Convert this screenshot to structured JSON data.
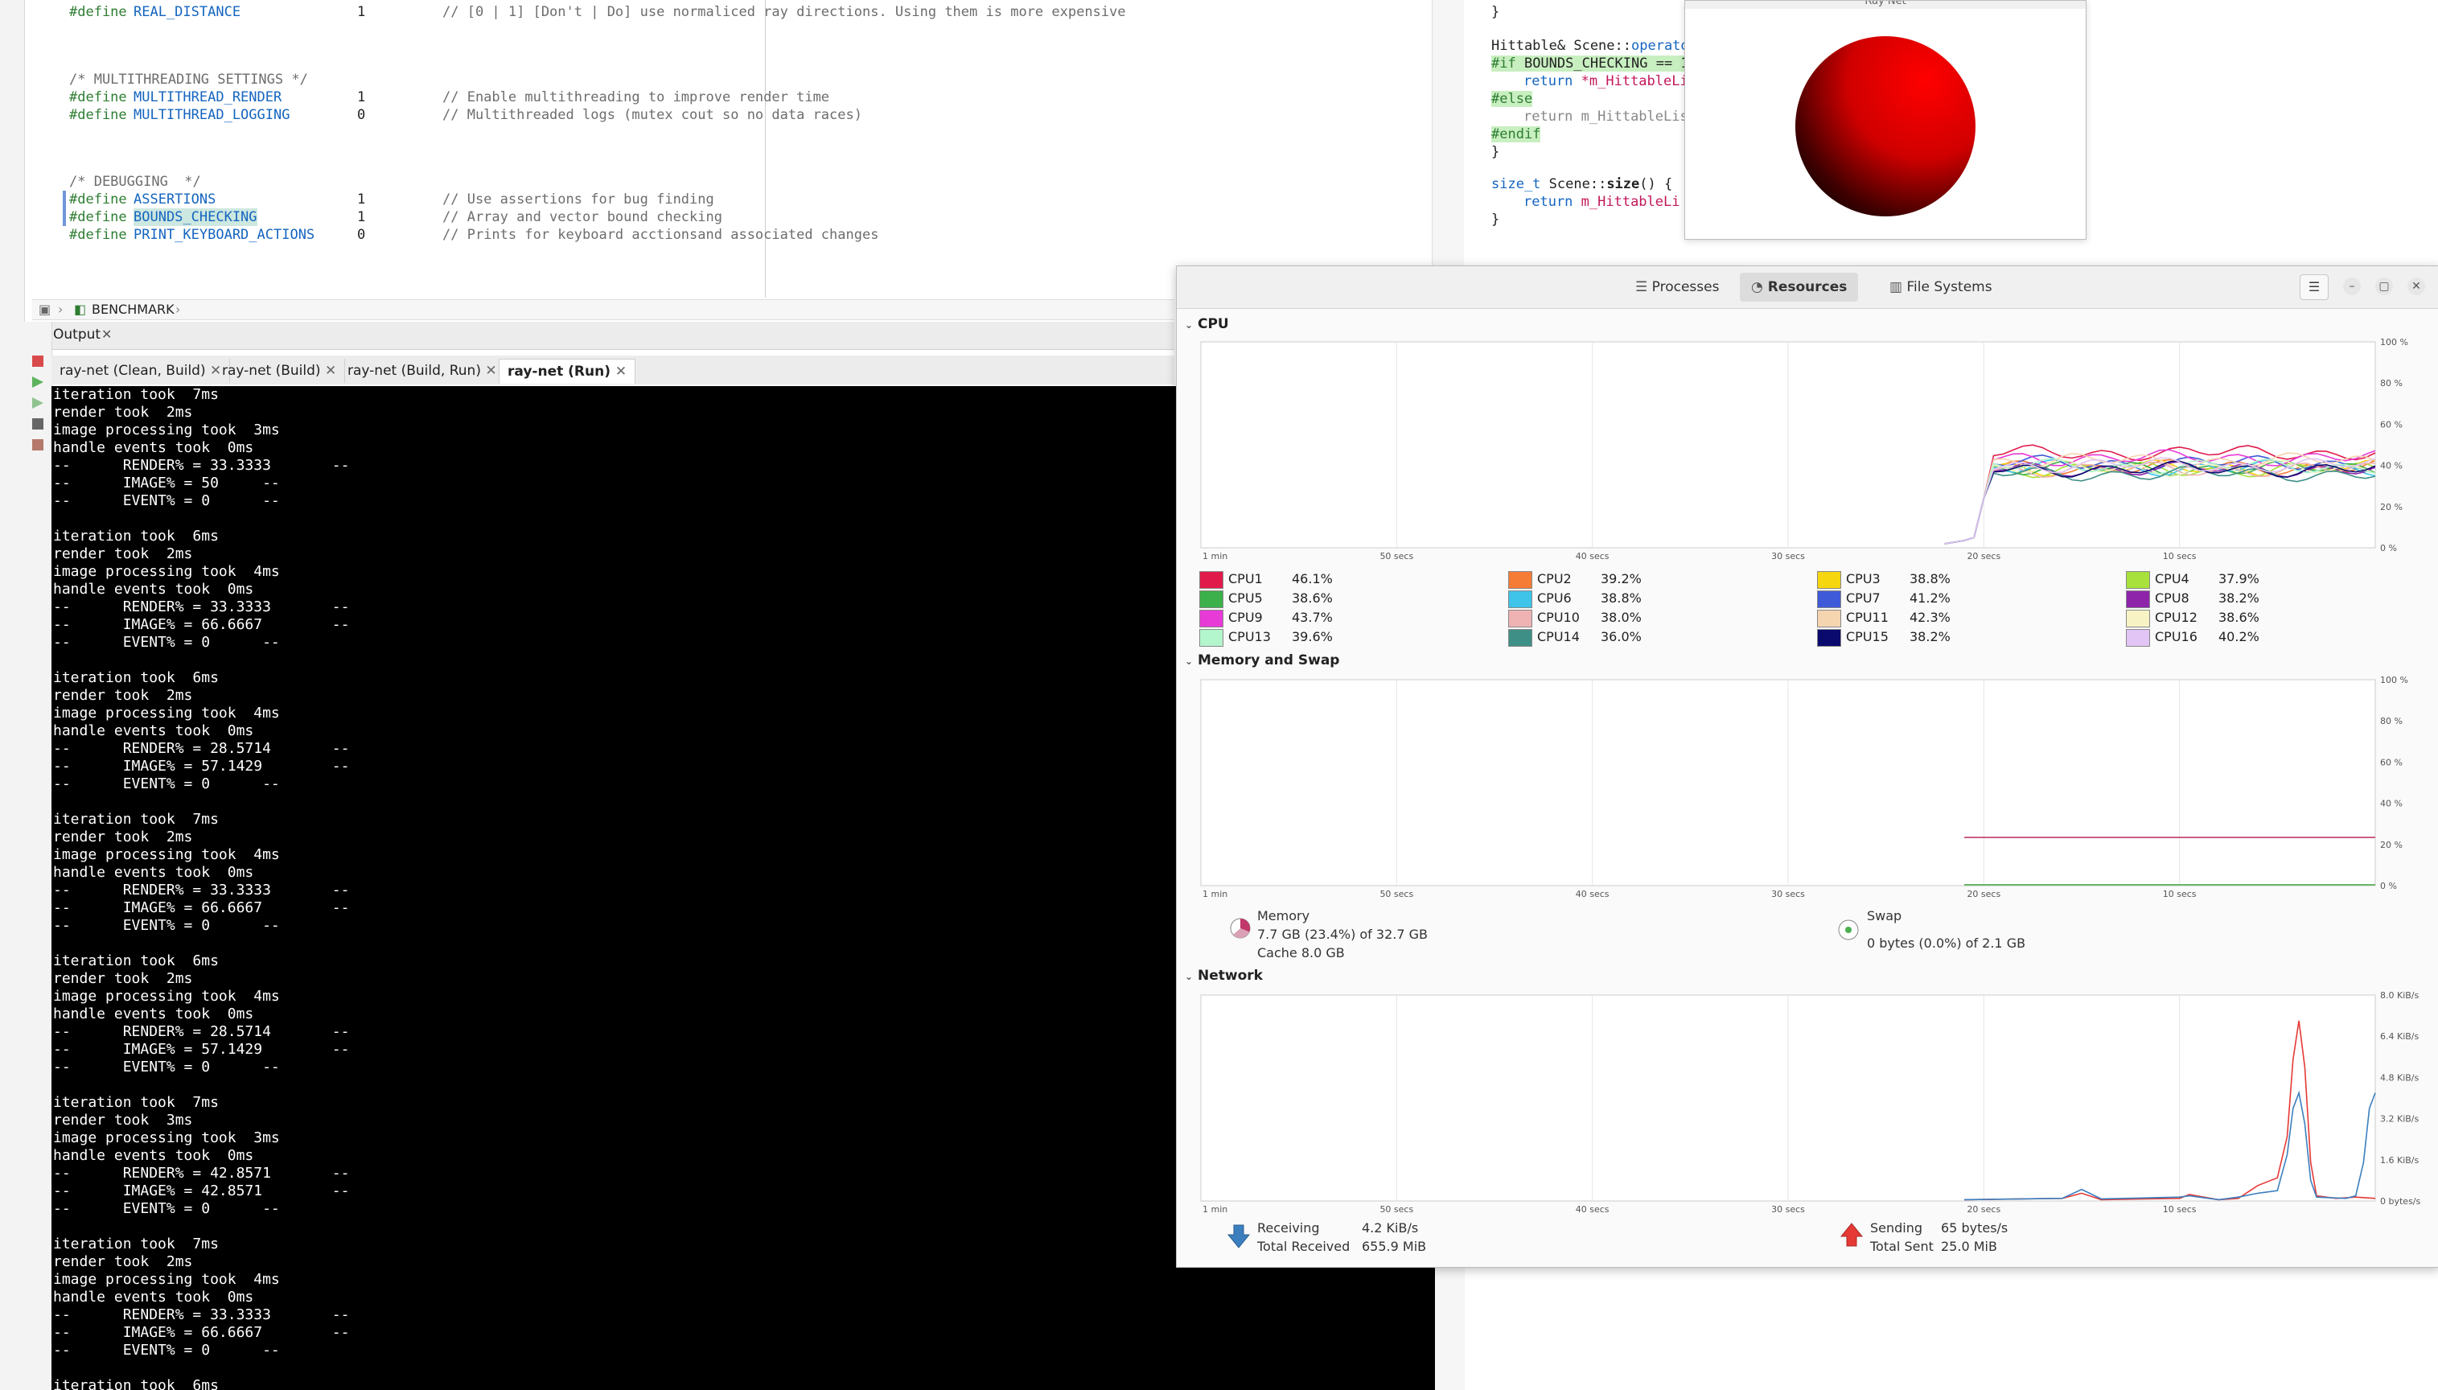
{
  "editor": {
    "lines": [
      {
        "kind": "define",
        "macro": "REAL_DISTANCE",
        "value": "1",
        "comment": "// [0 | 1] [Don't | Do] use normaliced ray directions. Using them is more expensive"
      },
      {
        "kind": "comment",
        "text": "/* MULTITHREADING SETTINGS */"
      },
      {
        "kind": "define",
        "macro": "MULTITHREAD_RENDER",
        "value": "1",
        "comment": "// Enable multithreading to improve render time"
      },
      {
        "kind": "define",
        "macro": "MULTITHREAD_LOGGING",
        "value": "0",
        "comment": "// Multithreaded logs (mutex cout so no data races)"
      },
      {
        "kind": "comment",
        "text": "/* DEBUGGING  */"
      },
      {
        "kind": "define",
        "macro": "ASSERTIONS",
        "value": "1",
        "comment": "// Use assertions for bug finding"
      },
      {
        "kind": "define",
        "macro": "BOUNDS_CHECKING",
        "value": "1",
        "comment": "// Array and vector bound checking"
      },
      {
        "kind": "define",
        "macro": "PRINT_KEYBOARD_ACTIONS",
        "value": "0",
        "comment": "// Prints for keyboard acctionsand associated changes"
      }
    ],
    "define_keyword": "#define",
    "breadcrumb": "BENCHMARK"
  },
  "output": {
    "title": "Output",
    "tabs": [
      "ray-net (Clean, Build)",
      "ray-net (Build)",
      "ray-net (Build, Run)",
      "ray-net (Run)"
    ],
    "active_tab": "ray-net (Run)",
    "terminal_lines": [
      "iteration took  7ms",
      "render took  2ms",
      "image processing took  3ms",
      "handle events took  0ms",
      "--      RENDER% = 33.3333       --",
      "--      IMAGE% = 50     --",
      "--      EVENT% = 0      --",
      "",
      "iteration took  6ms",
      "render took  2ms",
      "image processing took  4ms",
      "handle events took  0ms",
      "--      RENDER% = 33.3333       --",
      "--      IMAGE% = 66.6667        --",
      "--      EVENT% = 0      --",
      "",
      "iteration took  6ms",
      "render took  2ms",
      "image processing took  4ms",
      "handle events took  0ms",
      "--      RENDER% = 28.5714       --",
      "--      IMAGE% = 57.1429        --",
      "--      EVENT% = 0      --",
      "",
      "iteration took  7ms",
      "render took  2ms",
      "image processing took  4ms",
      "handle events took  0ms",
      "--      RENDER% = 33.3333       --",
      "--      IMAGE% = 66.6667        --",
      "--      EVENT% = 0      --",
      "",
      "iteration took  6ms",
      "render took  2ms",
      "image processing took  4ms",
      "handle events took  0ms",
      "--      RENDER% = 28.5714       --",
      "--      IMAGE% = 57.1429        --",
      "--      EVENT% = 0      --",
      "",
      "iteration took  7ms",
      "render took  3ms",
      "image processing took  3ms",
      "handle events took  0ms",
      "--      RENDER% = 42.8571       --",
      "--      IMAGE% = 42.8571        --",
      "--      EVENT% = 0      --",
      "",
      "iteration took  7ms",
      "render took  2ms",
      "image processing took  4ms",
      "handle events took  0ms",
      "--      RENDER% = 33.3333       --",
      "--      IMAGE% = 66.6667        --",
      "--      EVENT% = 0      --",
      "",
      "iteration took  6ms"
    ]
  },
  "right_editor": {
    "line1": "}",
    "line2_a": "Hittable& Scene::",
    "line2_b": "operato",
    "line3_a": "#if",
    "line3_b": " BOUNDS_CHECKING == 1",
    "line4_a": "return ",
    "line4_b": "*m_HittableLi",
    "line5": "#else",
    "line6_a": "return ",
    "line6_b": "m_HittableLis",
    "line7": "#endif",
    "line8": "}",
    "line9_a": "size_t",
    "line9_b": " Scene::",
    "line9_c": "size",
    "line9_d": "() {",
    "line10_a": "return ",
    "line10_b": "m_HittableLi",
    "line11": "}"
  },
  "raynet": {
    "title": "Ray Net",
    "sphere_color": "#ff0000"
  },
  "sysmon": {
    "tabs": [
      "Processes",
      "Resources",
      "File Systems"
    ],
    "active_tab": "Resources",
    "time_labels": [
      "1 min",
      "50 secs",
      "40 secs",
      "30 secs",
      "20 secs",
      "10 secs"
    ],
    "cpu": {
      "title": "CPU",
      "y_labels": [
        "100 %",
        "80 %",
        "60 %",
        "40 %",
        "20 %",
        "0 %"
      ],
      "cores": [
        {
          "name": "CPU1",
          "value": "46.1%",
          "color": "#e01b4c"
        },
        {
          "name": "CPU2",
          "value": "39.2%",
          "color": "#f57c35"
        },
        {
          "name": "CPU3",
          "value": "38.8%",
          "color": "#f5d60f"
        },
        {
          "name": "CPU4",
          "value": "37.9%",
          "color": "#a8e03c"
        },
        {
          "name": "CPU5",
          "value": "38.6%",
          "color": "#3cb04a"
        },
        {
          "name": "CPU6",
          "value": "38.8%",
          "color": "#3dc4e8"
        },
        {
          "name": "CPU7",
          "value": "41.2%",
          "color": "#3f5ad8"
        },
        {
          "name": "CPU8",
          "value": "38.2%",
          "color": "#8e24aa"
        },
        {
          "name": "CPU9",
          "value": "43.7%",
          "color": "#e83ad6"
        },
        {
          "name": "CPU10",
          "value": "38.0%",
          "color": "#f0b3b3"
        },
        {
          "name": "CPU11",
          "value": "42.3%",
          "color": "#f5d4b0"
        },
        {
          "name": "CPU12",
          "value": "38.6%",
          "color": "#f7f3c4"
        },
        {
          "name": "CPU13",
          "value": "39.6%",
          "color": "#b3f5cc"
        },
        {
          "name": "CPU14",
          "value": "36.0%",
          "color": "#3e8f86"
        },
        {
          "name": "CPU15",
          "value": "38.2%",
          "color": "#0a0a6e"
        },
        {
          "name": "CPU16",
          "value": "40.2%",
          "color": "#e2c4f5"
        }
      ]
    },
    "memory": {
      "title": "Memory and Swap",
      "y_labels": [
        "100 %",
        "80 %",
        "60 %",
        "40 %",
        "20 %",
        "0 %"
      ],
      "mem_label": "Memory",
      "mem_usage": "7.7 GB (23.4%) of 32.7 GB",
      "cache": "Cache 8.0 GB",
      "swap_label": "Swap",
      "swap_usage": "0 bytes (0.0%) of 2.1 GB",
      "mem_color": "#c0396b",
      "swap_color": "#4caf50"
    },
    "network": {
      "title": "Network",
      "y_labels": [
        "8.0 KiB/s",
        "6.4 KiB/s",
        "4.8 KiB/s",
        "3.2 KiB/s",
        "1.6 KiB/s",
        "0 bytes/s"
      ],
      "receiving_label": "Receiving",
      "receiving_value": "4.2 KiB/s",
      "total_received_label": "Total Received",
      "total_received_value": "655.9 MiB",
      "sending_label": "Sending",
      "sending_value": "65 bytes/s",
      "total_sent_label": "Total Sent",
      "total_sent_value": "25.0 MiB",
      "recv_color": "#3b7fbf",
      "send_color": "#e53935"
    }
  }
}
